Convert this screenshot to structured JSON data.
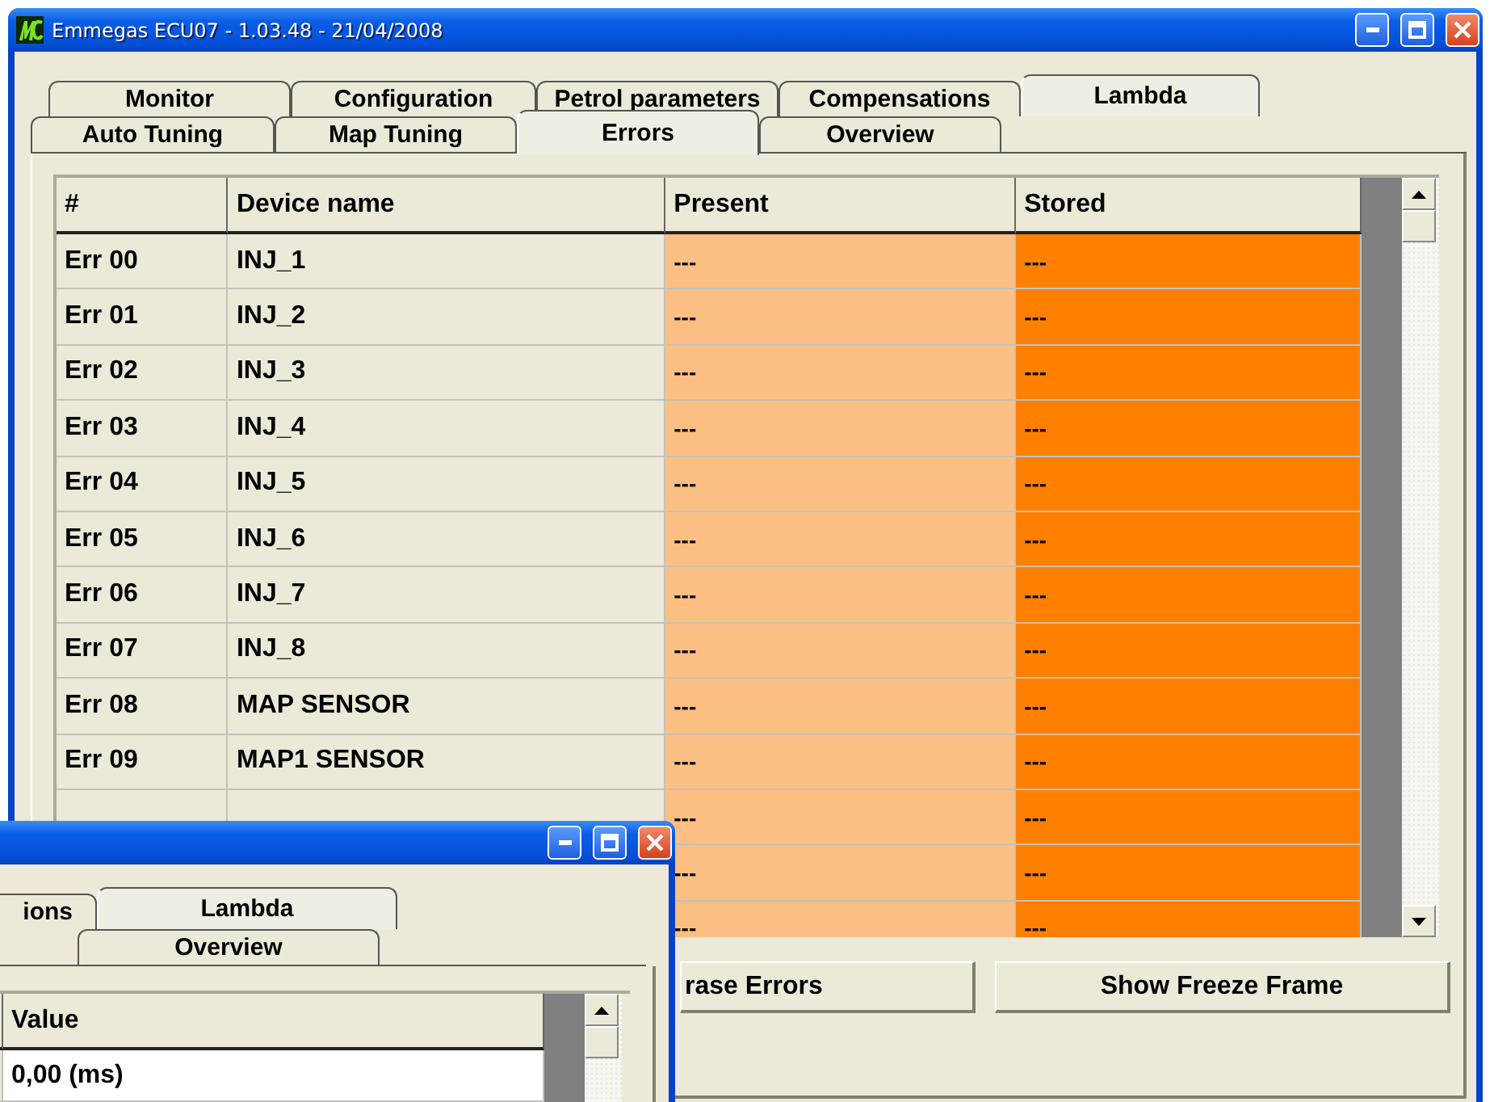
{
  "main_window": {
    "title": "Emmegas ECU07 - 1.03.48 - 21/04/2008",
    "tab_rows": [
      [
        {
          "label": "Monitor",
          "selected": false
        },
        {
          "label": "Configuration",
          "selected": false
        },
        {
          "label": "Petrol parameters",
          "selected": false
        },
        {
          "label": "Compensations",
          "selected": false
        },
        {
          "label": "Lambda",
          "selected": true
        }
      ],
      [
        {
          "label": "Auto Tuning",
          "selected": false
        },
        {
          "label": "Map Tuning",
          "selected": false
        },
        {
          "label": "Errors",
          "selected": true
        },
        {
          "label": "Overview",
          "selected": false
        }
      ]
    ],
    "errors_table": {
      "columns": [
        {
          "label": "#"
        },
        {
          "label": "Device name"
        },
        {
          "label": "Present",
          "color": "#fbbf84"
        },
        {
          "label": "Stored",
          "color": "#ff8000"
        }
      ],
      "rows": [
        {
          "number": "Err 00",
          "device_name": "INJ_1",
          "present": "---",
          "stored": "---"
        },
        {
          "number": "Err 01",
          "device_name": "INJ_2",
          "present": "---",
          "stored": "---"
        },
        {
          "number": "Err 02",
          "device_name": "INJ_3",
          "present": "---",
          "stored": "---"
        },
        {
          "number": "Err 03",
          "device_name": "INJ_4",
          "present": "---",
          "stored": "---"
        },
        {
          "number": "Err 04",
          "device_name": "INJ_5",
          "present": "---",
          "stored": "---"
        },
        {
          "number": "Err 05",
          "device_name": "INJ_6",
          "present": "---",
          "stored": "---"
        },
        {
          "number": "Err 06",
          "device_name": "INJ_7",
          "present": "---",
          "stored": "---"
        },
        {
          "number": "Err 07",
          "device_name": "INJ_8",
          "present": "---",
          "stored": "---"
        },
        {
          "number": "Err 08",
          "device_name": "MAP SENSOR",
          "present": "---",
          "stored": "---"
        },
        {
          "number": "Err 09",
          "device_name": "MAP1 SENSOR",
          "present": "---",
          "stored": "---"
        },
        {
          "present": "---",
          "stored": "---"
        },
        {
          "present": "---",
          "stored": "---"
        },
        {
          "present": "---",
          "stored": "---"
        }
      ]
    },
    "buttons": [
      "rase Errors",
      "Show Freeze Frame"
    ]
  },
  "second_window": {
    "tab_rows": [
      [
        {
          "label": "ions",
          "selected": false
        },
        {
          "label": "Lambda",
          "selected": true
        }
      ],
      [
        {
          "label": "Overview",
          "selected": false
        }
      ]
    ],
    "table": {
      "columns": [
        {
          "label": "Value"
        }
      ],
      "rows": [
        {
          "value": "0,00 (ms)"
        }
      ]
    }
  }
}
